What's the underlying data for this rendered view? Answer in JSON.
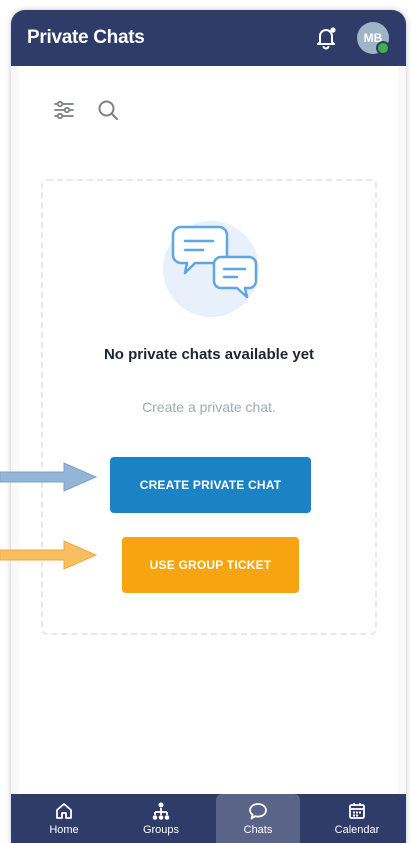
{
  "header": {
    "title": "Private Chats",
    "avatar_initials": "MB"
  },
  "icons": {
    "filter": "sliders-icon",
    "search": "search-icon",
    "notification": "bell-icon",
    "empty_state": "chat-bubbles-icon"
  },
  "empty_state": {
    "title": "No private chats available yet",
    "subtitle": "Create a private chat."
  },
  "buttons": {
    "create_label": "CREATE PRIVATE CHAT",
    "ticket_label": "USE GROUP TICKET"
  },
  "bottom_nav": {
    "items": [
      {
        "label": "Home",
        "icon": "home-icon"
      },
      {
        "label": "Groups",
        "icon": "groups-icon"
      },
      {
        "label": "Chats",
        "icon": "chat-icon",
        "active": true
      },
      {
        "label": "Calendar",
        "icon": "calendar-icon"
      }
    ]
  },
  "colors": {
    "header_bg": "#2f3b68",
    "primary_button": "#1b82c5",
    "secondary_button": "#f7a411",
    "online_status": "#3fb04a"
  }
}
